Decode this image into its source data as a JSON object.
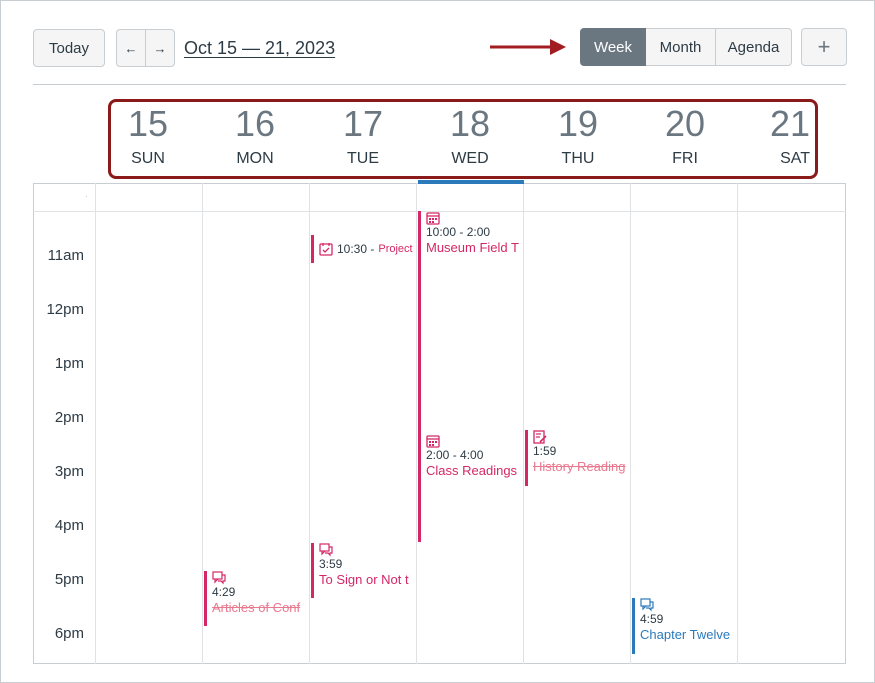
{
  "toolbar": {
    "today_label": "Today",
    "prev_label": "←",
    "next_label": "→",
    "date_range": "Oct 15 — 21, 2023",
    "views": [
      "Week",
      "Month",
      "Agenda"
    ],
    "active_view": "Week",
    "add_label": "+"
  },
  "days": [
    {
      "num": "15",
      "name": "SUN"
    },
    {
      "num": "16",
      "name": "MON"
    },
    {
      "num": "17",
      "name": "TUE"
    },
    {
      "num": "18",
      "name": "WED"
    },
    {
      "num": "19",
      "name": "THU"
    },
    {
      "num": "20",
      "name": "FRI"
    },
    {
      "num": "21",
      "name": "SAT"
    }
  ],
  "all_day_marker": "·",
  "times": [
    "11am",
    "12pm",
    "1pm",
    "2pm",
    "3pm",
    "4pm",
    "5pm",
    "6pm"
  ],
  "events": [
    {
      "day": "TUE",
      "time": "10:30 -",
      "title": "Project",
      "icon": "assignment-icon",
      "completed": false,
      "color": "#d52765"
    },
    {
      "day": "WED",
      "time": "10:00 - 2:00",
      "title": "Museum Field T",
      "icon": "calendar-event-icon",
      "completed": false,
      "color": "#d52765"
    },
    {
      "day": "WED",
      "time": "2:00 - 4:00",
      "title": "Class Readings",
      "icon": "calendar-event-icon",
      "completed": false,
      "color": "#d52765"
    },
    {
      "day": "THU",
      "time": "1:59",
      "title": "History Reading",
      "icon": "quiz-icon",
      "completed": true,
      "color": "#d52765"
    },
    {
      "day": "TUE",
      "time": "3:59",
      "title": "To Sign or Not t",
      "icon": "discussion-icon",
      "completed": false,
      "color": "#d52765"
    },
    {
      "day": "MON",
      "time": "4:29",
      "title": "Articles of Conf",
      "icon": "discussion-icon",
      "completed": true,
      "color": "#d52765"
    },
    {
      "day": "FRI",
      "time": "4:59",
      "title": "Chapter Twelve",
      "icon": "discussion-icon",
      "completed": false,
      "color": "#2b7abc"
    }
  ],
  "colors": {
    "accent": "#2b7abc",
    "event_pink": "#d52765",
    "highlight_box": "#8b1a1a",
    "active_view_bg": "#6b7780"
  }
}
